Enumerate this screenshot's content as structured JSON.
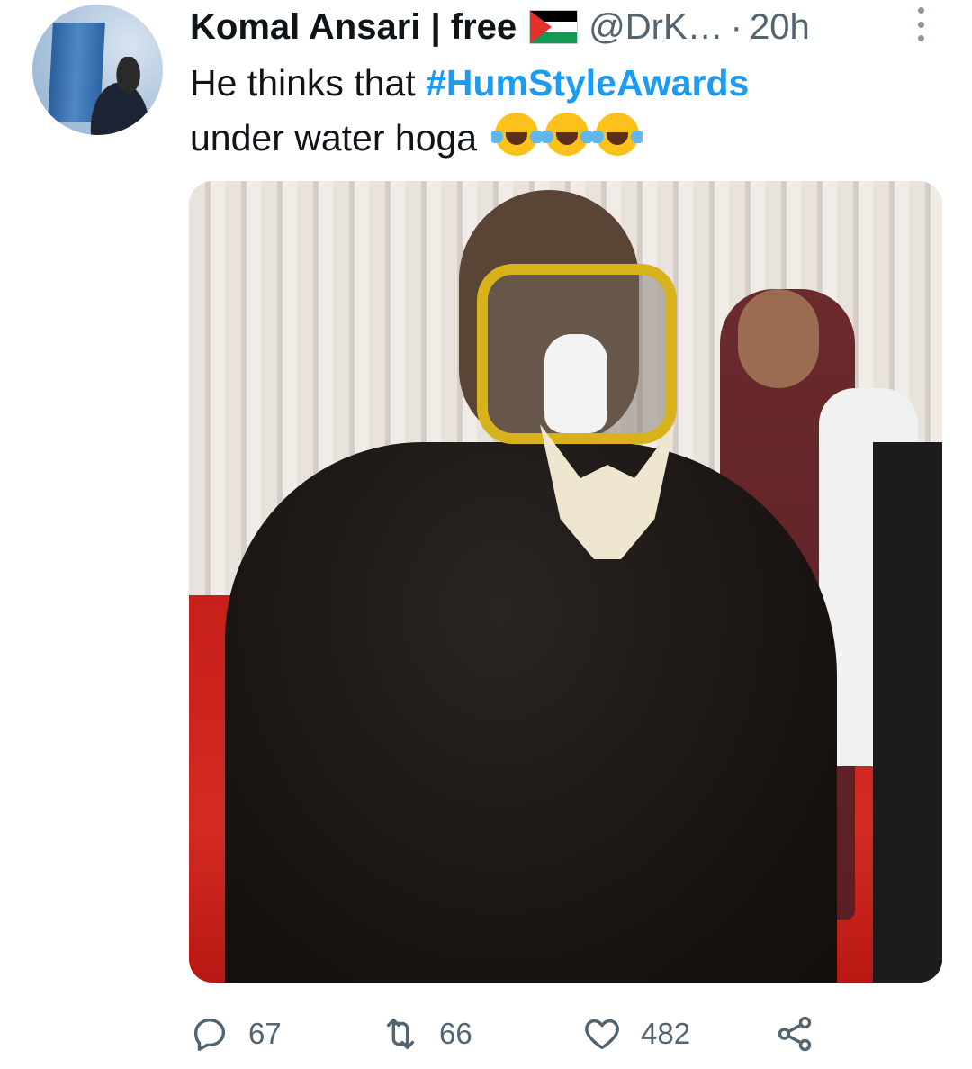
{
  "tweet": {
    "author_name": "Komal Ansari | free",
    "handle": "@DrK…",
    "separator": "·",
    "time": "20h",
    "text_before": "He thinks that ",
    "hashtag": "#HumStyleAwards",
    "text_after": "under water hoga",
    "emojis": [
      "face-with-tears-of-joy",
      "face-with-tears-of-joy",
      "face-with-tears-of-joy"
    ]
  },
  "actions": {
    "replies": "67",
    "retweets": "66",
    "likes": "482"
  },
  "icons": [
    "more-icon",
    "reply-icon",
    "retweet-icon",
    "like-icon",
    "share-icon"
  ],
  "colors": {
    "link": "#1d9bf0",
    "secondary_text": "#536471"
  }
}
